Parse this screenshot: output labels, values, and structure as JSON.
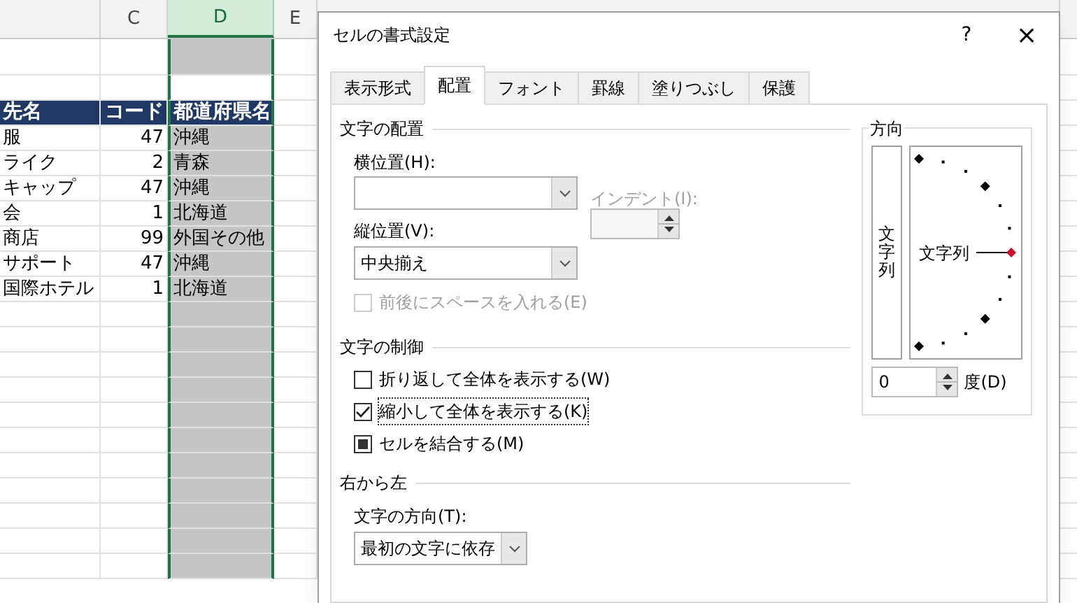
{
  "sheet": {
    "columns": [
      {
        "label": "C",
        "selected": false
      },
      {
        "label": "D",
        "selected": true
      },
      {
        "label": "E",
        "selected": false
      }
    ],
    "rows": [
      {
        "kind": "blank"
      },
      {
        "kind": "blank"
      },
      {
        "kind": "header",
        "cells": [
          "先名",
          "コード",
          "都道府県名"
        ]
      },
      {
        "kind": "data",
        "cells": [
          "服",
          "47",
          "沖縄"
        ]
      },
      {
        "kind": "data",
        "cells": [
          "ライク",
          "2",
          "青森"
        ]
      },
      {
        "kind": "data",
        "cells": [
          "キャップ",
          "47",
          "沖縄"
        ]
      },
      {
        "kind": "data",
        "cells": [
          "会",
          "1",
          "北海道"
        ]
      },
      {
        "kind": "data",
        "cells": [
          "商店",
          "99",
          "外国その他"
        ]
      },
      {
        "kind": "data",
        "cells": [
          "サポート",
          "47",
          "沖縄"
        ]
      },
      {
        "kind": "data",
        "cells": [
          "国際ホテル",
          "1",
          "北海道"
        ]
      }
    ]
  },
  "dialog": {
    "title": "セルの書式設定",
    "help": "?",
    "close": "×",
    "tabs": [
      {
        "label": "表示形式",
        "selected": false
      },
      {
        "label": "配置",
        "selected": true
      },
      {
        "label": "フォント",
        "selected": false
      },
      {
        "label": "罫線",
        "selected": false
      },
      {
        "label": "塗りつぶし",
        "selected": false
      },
      {
        "label": "保護",
        "selected": false
      }
    ],
    "alignment": {
      "title": "文字の配置",
      "horizontal": {
        "label": "横位置(H):"
      },
      "vertical": {
        "label": "縦位置(V):",
        "value": "中央揃え"
      },
      "indent": {
        "label": "インデント(I):",
        "disabled": true
      },
      "distributed": {
        "label": "前後にスペースを入れる(E)",
        "checked": false,
        "disabled": true
      }
    },
    "control": {
      "title": "文字の制御",
      "options": [
        {
          "label": "折り返して全体を表示する(W)",
          "checked": false,
          "mixed": false,
          "focused": false
        },
        {
          "label": "縮小して全体を表示する(K)",
          "checked": true,
          "mixed": false,
          "focused": true
        },
        {
          "label": "セルを結合する(M)",
          "checked": false,
          "mixed": true,
          "focused": false
        }
      ]
    },
    "rtl": {
      "title": "右から左",
      "direction": {
        "label": "文字の方向(T):",
        "value": "最初の文字に依存"
      }
    },
    "orientation": {
      "title": "方向",
      "vertical_text": "文字列",
      "dial_text": "文字列",
      "degrees": {
        "value": "0",
        "label": "度(D)"
      }
    }
  }
}
